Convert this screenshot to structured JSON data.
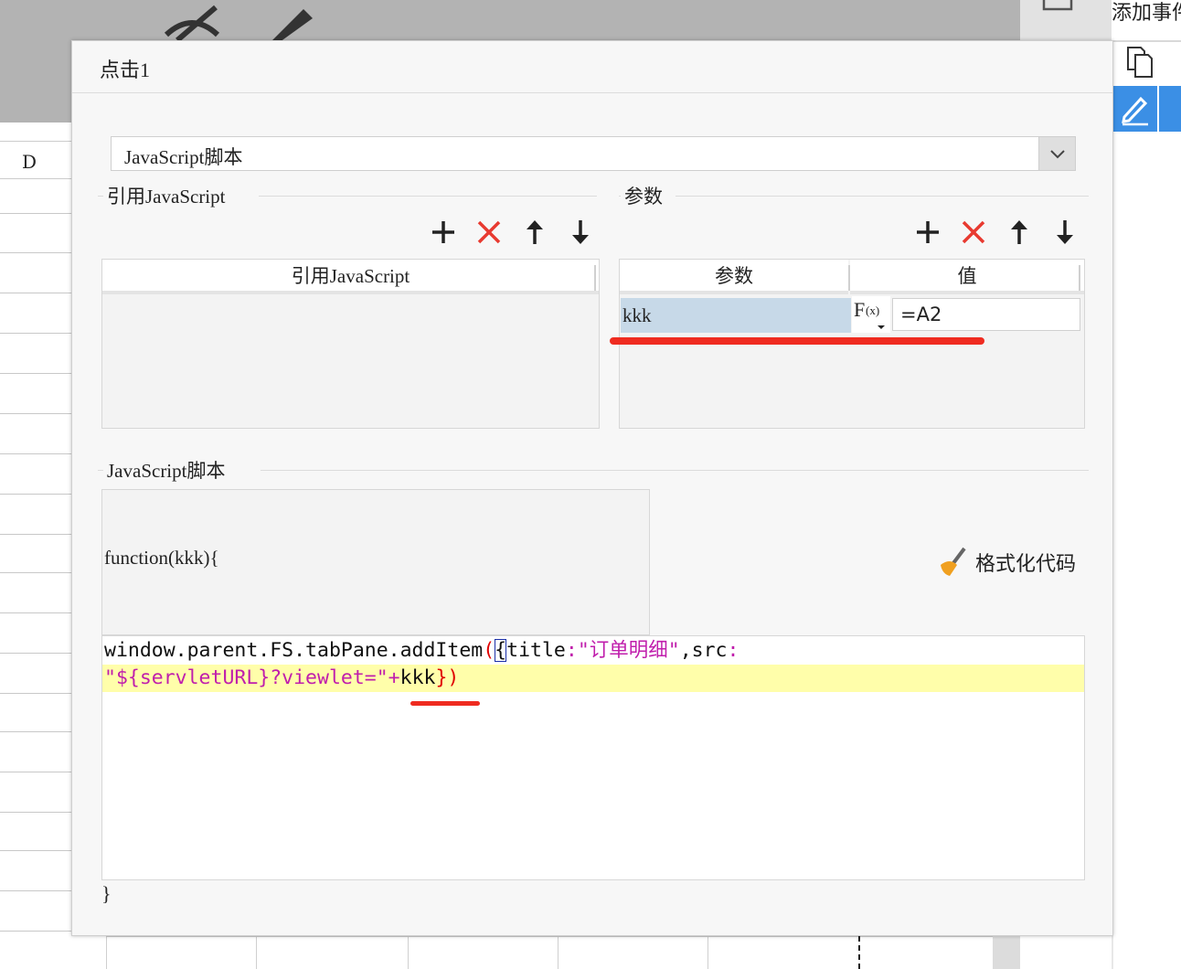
{
  "background": {
    "column_header": "D",
    "right_panel_title": "添加事件"
  },
  "dialog": {
    "title": "点击1",
    "script_type_select": {
      "value": "JavaScript脚本"
    },
    "ref_js_section": {
      "label": "引用JavaScript",
      "table_header": "引用JavaScript",
      "rows": []
    },
    "params_section": {
      "label": "参数",
      "columns": [
        "参数",
        "值"
      ],
      "rows": [
        {
          "name": "kkk",
          "value": "=A2"
        }
      ]
    },
    "toolbar_icons": [
      "add-icon",
      "delete-icon",
      "move-up-icon",
      "move-down-icon"
    ],
    "script_section": {
      "label": "JavaScript脚本",
      "function_signature": "function(kkk){",
      "format_button": "格式化代码",
      "code_line1": {
        "obj": "window.parent.FS.tabPane.addItem",
        "open_paren": "(",
        "open_brace": "{",
        "key1": "title",
        "colon1": ":",
        "str1": "\"订单明细\"",
        "comma": ",",
        "key2": "src",
        "colon2": ":"
      },
      "code_line2": {
        "str2": "\"${servletURL}?viewlet=\"",
        "plus": "+",
        "var": "kkk",
        "close": "})"
      },
      "closing": "}"
    },
    "colors": {
      "string": "#c01eac",
      "highlight_line": "#fffeaa",
      "selected_row": "#c7d9e8",
      "annotation": "#ef2b20",
      "delete_icon": "#e83a30"
    }
  }
}
